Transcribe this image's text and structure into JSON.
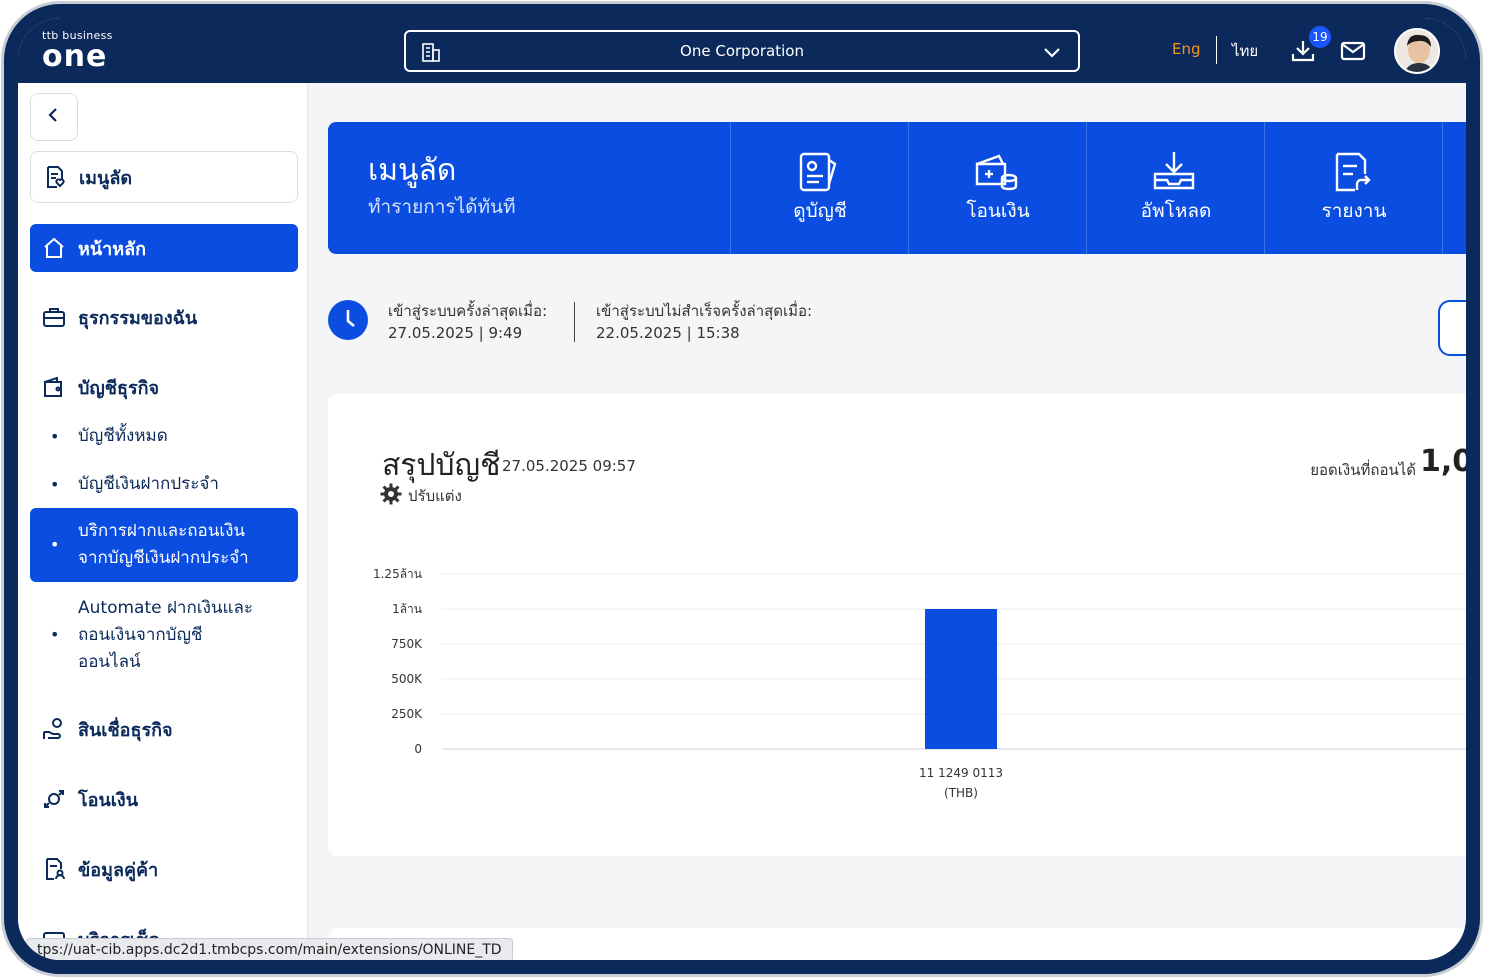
{
  "header": {
    "logo_small": "ttb business",
    "logo_big": "one",
    "company": "One Corporation",
    "lang_eng": "Eng",
    "lang_th": "ไทย",
    "download_count": "19",
    "colors": {
      "header_bg": "#0b2a5b",
      "accent_orange": "#f7941d",
      "brand_blue": "#0a4de0"
    }
  },
  "sidebar": {
    "quick_menu": "เมนูลัด",
    "home": "หน้าหลัก",
    "my_transactions": "ธุรกรรมของฉัน",
    "business_accounts": "บัญชีธุรกิจ",
    "sub_items": [
      "บัญชีทั้งหมด",
      "บัญชีเงินฝากประจำ",
      "บริการฝากและถอนเงิน\nจากบัญชีเงินฝากประจำ",
      "Automate ฝากเงินและ\nถอนเงินจากบัญชี\nออนไลน์"
    ],
    "business_loans": "สินเชื่อธุรกิจ",
    "transfer": "โอนเงิน",
    "counterparty": "ข้อมูลคู่ค้า",
    "cut_off_item": "บริการเช็ค"
  },
  "quick_banner": {
    "title": "เมนูลัด",
    "subtitle": "ทำรายการได้ทันที",
    "items": [
      {
        "label": "ดูบัญชี",
        "icon": "account-book-icon"
      },
      {
        "label": "โอนเงิน",
        "icon": "transfer-wallet-icon"
      },
      {
        "label": "อัพโหลด",
        "icon": "upload-tray-icon"
      },
      {
        "label": "รายงาน",
        "icon": "report-doc-icon"
      }
    ]
  },
  "login_info": {
    "last_login_label": "เข้าสู่ระบบครั้งล่าสุดเมื่อ:",
    "last_login_value": "27.05.2025 | 9:49",
    "last_failed_label": "เข้าสู่ระบบไม่สำเร็จครั้งล่าสุดเมื่อ:",
    "last_failed_value": "22.05.2025 | 15:38"
  },
  "summary": {
    "title": "สรุปบัญชี",
    "timestamp": "27.05.2025 09:57",
    "adjust_label": "ปรับแต่ง",
    "available_label": "ยอดเงินที่ถอนได้",
    "available_value": "1,0"
  },
  "chart_data": {
    "type": "bar",
    "categories": [
      "11 1249 0113\n(THB)"
    ],
    "values": [
      1000000
    ],
    "y_ticks": [
      "0",
      "250K",
      "500K",
      "750K",
      "1ล้าน",
      "1.25ล้าน"
    ],
    "y_tick_values": [
      0,
      250000,
      500000,
      750000,
      1000000,
      1250000
    ],
    "ylim": [
      0,
      1250000
    ],
    "grid": true,
    "color": "#0a4de0"
  },
  "status_bar": {
    "url": "tps://uat-cib.apps.dc2d1.tmbcps.com/main/extensions/ONLINE_TD"
  }
}
